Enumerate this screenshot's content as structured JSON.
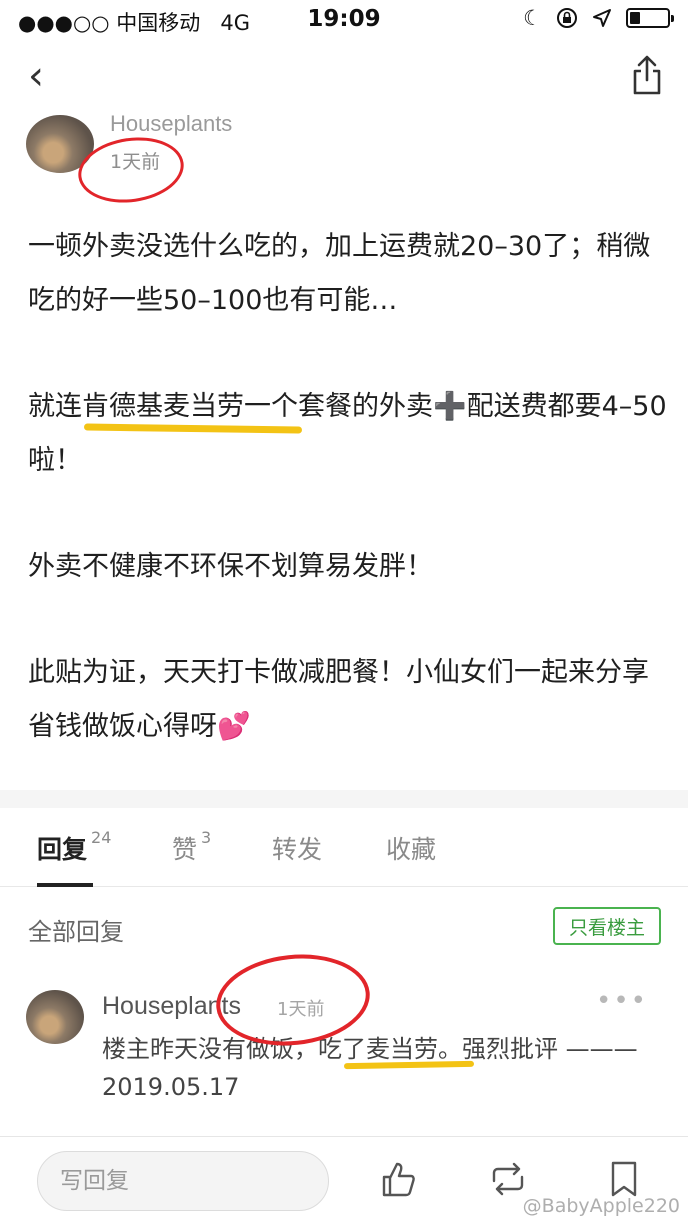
{
  "status_bar": {
    "carrier": "●●●○○ 中国移动",
    "network": "4G",
    "time": "19:09"
  },
  "post": {
    "author": "Houseplants",
    "time": "1天前",
    "paragraphs": [
      "一顿外卖没选什么吃的，加上运费就20–30了；稍微吃的好一些50–100也有可能…",
      "就连肯德基麦当劳一个套餐的外卖➕配送费都要4–50啦！",
      "外卖不健康不环保不划算易发胖！",
      "此贴为证，天天打卡做减肥餐！小仙女们一起来分享省钱做饭心得呀💕"
    ]
  },
  "tabs": [
    {
      "label": "回复",
      "count": "24"
    },
    {
      "label": "赞",
      "count": "3"
    },
    {
      "label": "转发",
      "count": ""
    },
    {
      "label": "收藏",
      "count": ""
    }
  ],
  "replies_section": {
    "title": "全部回复",
    "owner_only_label": "只看楼主"
  },
  "reply": {
    "author": "Houseplants",
    "time": "1天前",
    "text": "楼主昨天没有做饭，吃了麦当劳。强烈批评 ———2019.05.17",
    "more": "•••"
  },
  "bottom_bar": {
    "input_placeholder": "写回复"
  },
  "watermark": "@BabyApple220",
  "colors": {
    "accent_green": "#4ab34f",
    "annotation_red": "#e2252a",
    "highlight_yellow": "#f3c315"
  }
}
